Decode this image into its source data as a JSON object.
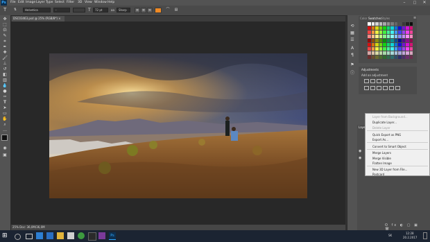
{
  "app": {
    "logo": "Ps"
  },
  "menu": [
    "File",
    "Edit",
    "Image",
    "Layer",
    "Type",
    "Select",
    "Filter",
    "3D",
    "View",
    "Window",
    "Help"
  ],
  "window_controls": [
    "–",
    "□",
    "✕"
  ],
  "options": {
    "font_family": "Helvetica",
    "font_style": "-",
    "font_size": "72 pt",
    "anti_alias": "Sharp",
    "aa_label": "aa"
  },
  "document": {
    "tab_title": "DSC03463.psd @ 25% (RGB/8*) ×",
    "status": "25%      Doc: 36,0M/36,0M"
  },
  "panels": {
    "swatch_tabs": [
      "Color",
      "Swatches",
      "Styles"
    ],
    "adjustments_title": "Adjustments",
    "adjustments_subtitle": "Add an adjustment",
    "layers_title": "Layers"
  },
  "context_menu": {
    "items": [
      {
        "label": "Layer from Background...",
        "enabled": false
      },
      {
        "label": "Duplicate Layer...",
        "enabled": true
      },
      {
        "label": "Delete Layer",
        "enabled": false
      },
      {
        "label": "Quick Export as PNG",
        "enabled": true
      },
      {
        "label": "Export As...",
        "enabled": true
      },
      {
        "label": "Convert to Smart Object",
        "enabled": true
      },
      {
        "label": "Merge Layers",
        "enabled": true
      },
      {
        "label": "Merge Visible",
        "enabled": true
      },
      {
        "label": "Flatten Image",
        "enabled": true
      },
      {
        "label": "New 3D Layer from File...",
        "enabled": true
      },
      {
        "label": "Postcard",
        "enabled": true
      }
    ]
  },
  "taskbar": {
    "time": "12:28",
    "date": "20.2.2017",
    "lang": "SK"
  },
  "colors": {
    "accent": "#31a8ff",
    "menu_bg": "#535353",
    "canvas_bg": "#282828",
    "taskbar_bg": "#1b2432"
  }
}
